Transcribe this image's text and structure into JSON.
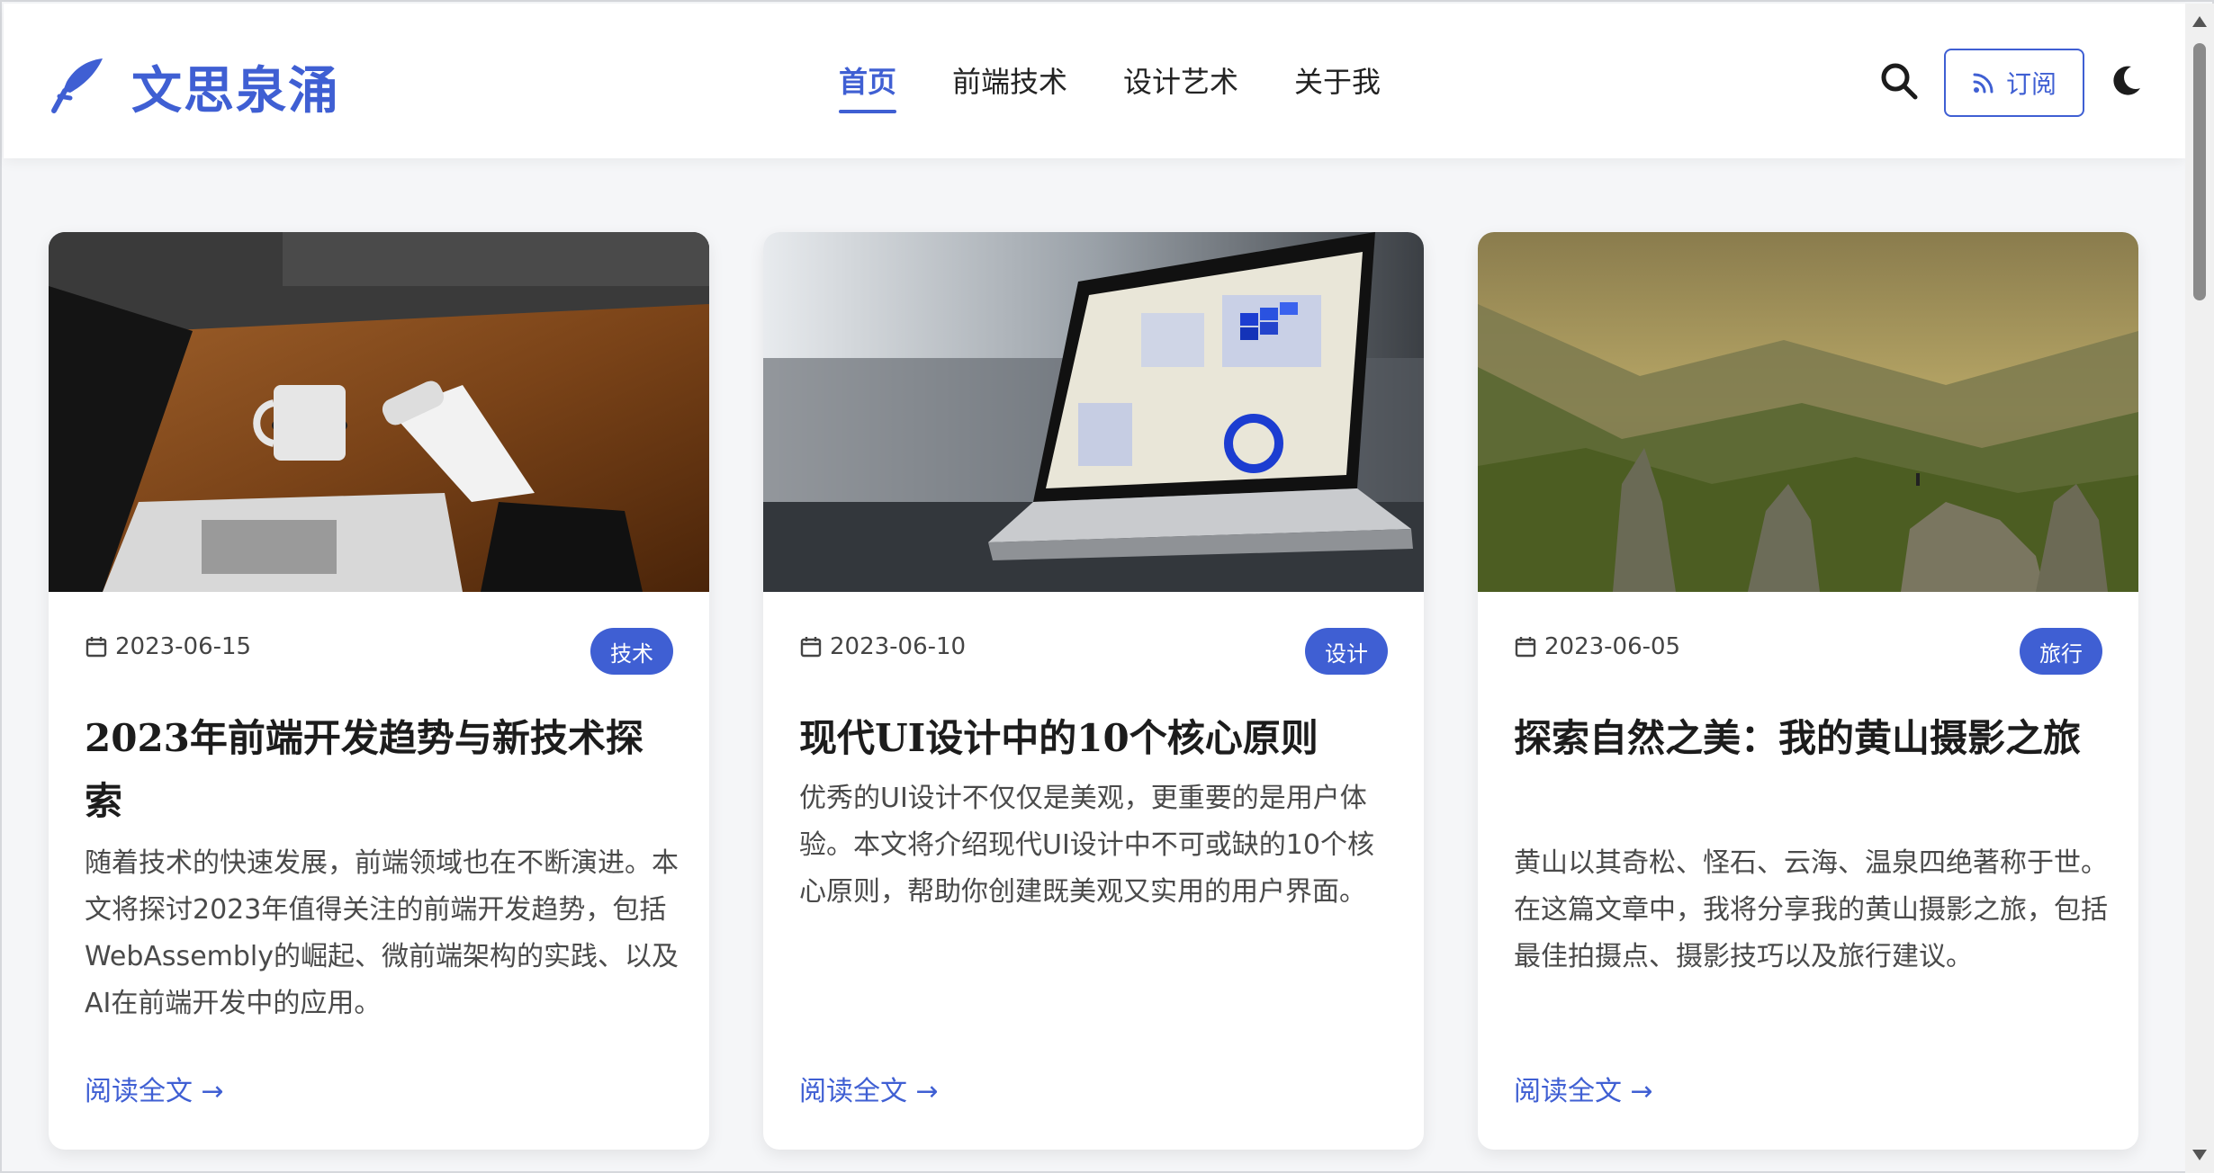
{
  "header": {
    "logo_text": "文思泉涌",
    "nav": [
      {
        "label": "首页",
        "active": true
      },
      {
        "label": "前端技术",
        "active": false
      },
      {
        "label": "设计艺术",
        "active": false
      },
      {
        "label": "关于我",
        "active": false
      }
    ],
    "subscribe_label": "订阅",
    "icons": {
      "logo": "feather-pen-icon",
      "search": "search-icon",
      "subscribe": "rss-icon",
      "theme": "moon-icon"
    }
  },
  "colors": {
    "accent": "#3f5fd3",
    "background": "#f5f6f8",
    "card": "#ffffff"
  },
  "articles": [
    {
      "date": "2023-06-15",
      "category": "技术",
      "title": "2023年前端开发趋势与新技术探索",
      "excerpt": "随着技术的快速发展，前端领域也在不断演进。本文将探讨2023年值得关注的前端开发趋势，包括WebAssembly的崛起、微前端架构的实践、以及AI在前端开发中的应用。",
      "read_more": "阅读全文 →",
      "image_alt": "laptop-coffee-desk-photo"
    },
    {
      "date": "2023-06-10",
      "category": "设计",
      "title": "现代UI设计中的10个核心原则",
      "excerpt": "优秀的UI设计不仅仅是美观，更重要的是用户体验。本文将介绍现代UI设计中不可或缺的10个核心原则，帮助你创建既美观又实用的用户界面。",
      "read_more": "阅读全文 →",
      "image_alt": "laptop-dashboard-photo"
    },
    {
      "date": "2023-06-05",
      "category": "旅行",
      "title": "探索自然之美：我的黄山摄影之旅",
      "excerpt": "黄山以其奇松、怪石、云海、温泉四绝著称于世。在这篇文章中，我将分享我的黄山摄影之旅，包括最佳拍摄点、摄影技巧以及旅行建议。",
      "read_more": "阅读全文 →",
      "image_alt": "mountain-landscape-photo"
    }
  ]
}
